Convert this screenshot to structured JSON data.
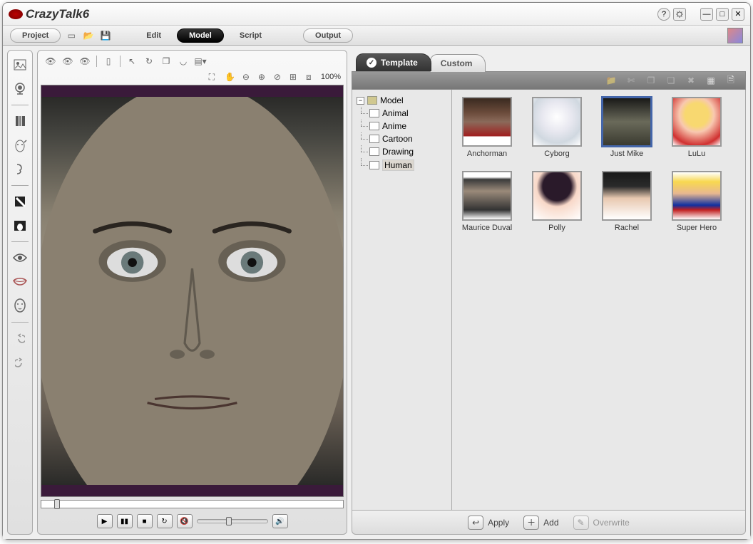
{
  "app": {
    "title": "CrazyTalk6"
  },
  "menubar": {
    "project": "Project",
    "edit": "Edit",
    "model": "Model",
    "script": "Script",
    "output": "Output"
  },
  "viewer": {
    "zoom": "100%"
  },
  "library": {
    "tabs": {
      "template": "Template",
      "custom": "Custom"
    },
    "tree": {
      "root": "Model",
      "children": [
        "Animal",
        "Anime",
        "Cartoon",
        "Drawing",
        "Human"
      ],
      "selected": "Human"
    },
    "items": [
      {
        "label": "Anchorman",
        "thumb": "thumb-anchor"
      },
      {
        "label": "Cyborg",
        "thumb": "thumb-cyborg"
      },
      {
        "label": "Just Mike",
        "thumb": "thumb-mike",
        "selected": true
      },
      {
        "label": "LuLu",
        "thumb": "thumb-lulu"
      },
      {
        "label": "Maurice Duval",
        "thumb": "thumb-maurice"
      },
      {
        "label": "Polly",
        "thumb": "thumb-polly"
      },
      {
        "label": "Rachel",
        "thumb": "thumb-rachel"
      },
      {
        "label": "Super Hero",
        "thumb": "thumb-hero"
      }
    ],
    "actions": {
      "apply": "Apply",
      "add": "Add",
      "overwrite": "Overwrite"
    }
  }
}
